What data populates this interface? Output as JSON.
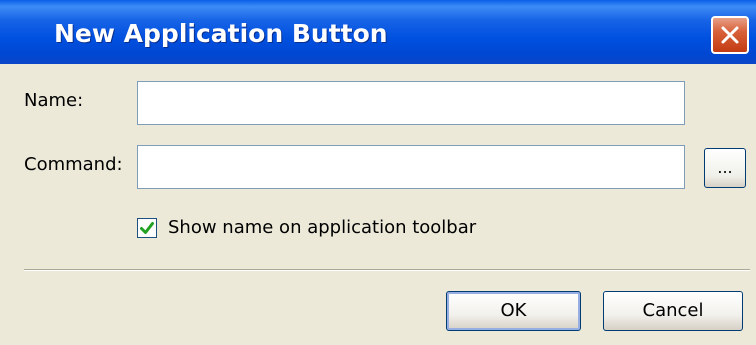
{
  "dialog": {
    "title": "New Application Button",
    "close_icon": "close-x-icon"
  },
  "form": {
    "name_label": "Name:",
    "name_value": "",
    "command_label": "Command:",
    "command_value": "",
    "browse_label": "...",
    "show_name_checked": true,
    "show_name_label": "Show name on application toolbar"
  },
  "buttons": {
    "ok_label": "OK",
    "cancel_label": "Cancel"
  },
  "colors": {
    "titlebar": "#0a5ee6",
    "dialog_bg": "#ece9d8",
    "close": "#c33b12",
    "check": "#21a121"
  }
}
